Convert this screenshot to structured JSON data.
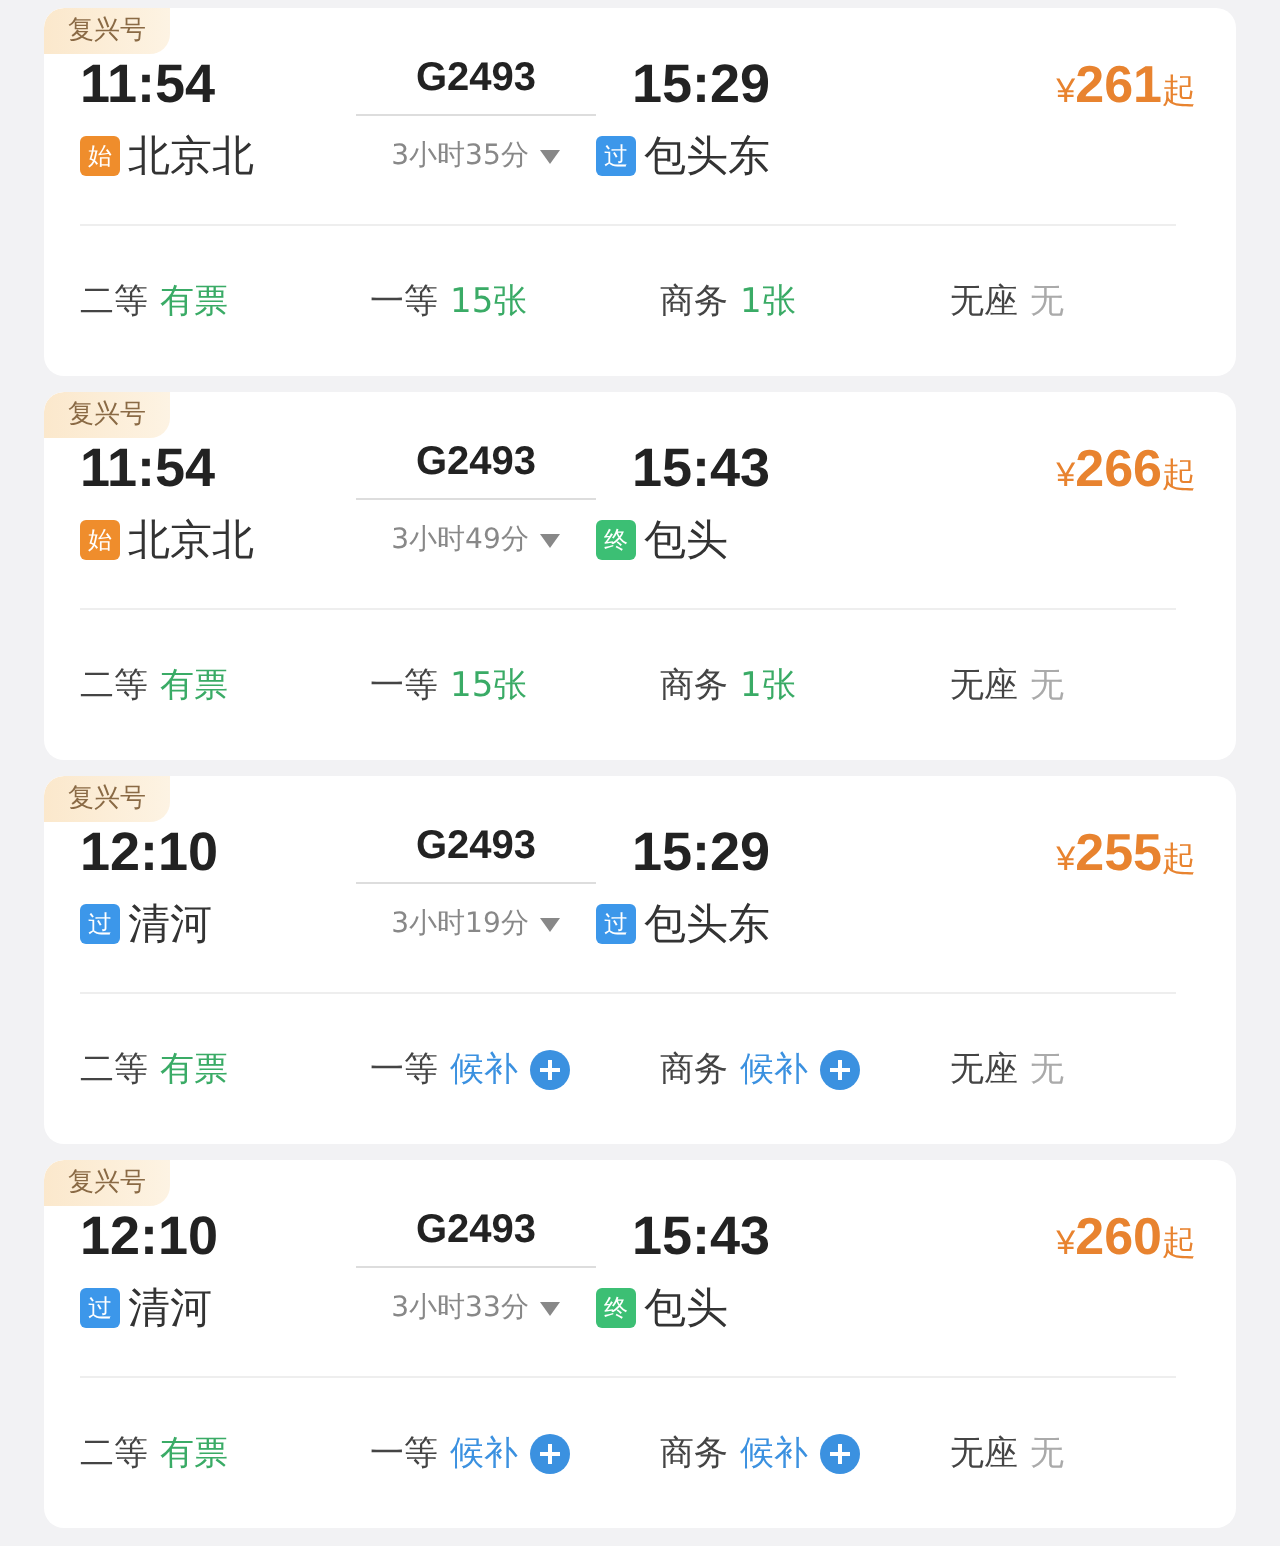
{
  "trains": [
    {
      "tag": "复兴号",
      "depart_time": "11:54",
      "train_no": "G2493",
      "arrive_time": "15:29",
      "price": {
        "currency": "¥",
        "amount": "261",
        "suffix": "起"
      },
      "duration": "3小时35分",
      "from": {
        "badge": "始",
        "kind": "start",
        "name": "北京北"
      },
      "to": {
        "badge": "过",
        "kind": "pass",
        "name": "包头东"
      },
      "seats": [
        {
          "class": "二等",
          "status": "有票",
          "kind": "available"
        },
        {
          "class": "一等",
          "status": "15张",
          "kind": "available"
        },
        {
          "class": "商务",
          "status": "1张",
          "kind": "available"
        },
        {
          "class": "无座",
          "status": "无",
          "kind": "none"
        }
      ]
    },
    {
      "tag": "复兴号",
      "depart_time": "11:54",
      "train_no": "G2493",
      "arrive_time": "15:43",
      "price": {
        "currency": "¥",
        "amount": "266",
        "suffix": "起"
      },
      "duration": "3小时49分",
      "from": {
        "badge": "始",
        "kind": "start",
        "name": "北京北"
      },
      "to": {
        "badge": "终",
        "kind": "end",
        "name": "包头"
      },
      "seats": [
        {
          "class": "二等",
          "status": "有票",
          "kind": "available"
        },
        {
          "class": "一等",
          "status": "15张",
          "kind": "available"
        },
        {
          "class": "商务",
          "status": "1张",
          "kind": "available"
        },
        {
          "class": "无座",
          "status": "无",
          "kind": "none"
        }
      ]
    },
    {
      "tag": "复兴号",
      "depart_time": "12:10",
      "train_no": "G2493",
      "arrive_time": "15:29",
      "price": {
        "currency": "¥",
        "amount": "255",
        "suffix": "起"
      },
      "duration": "3小时19分",
      "from": {
        "badge": "过",
        "kind": "pass",
        "name": "清河"
      },
      "to": {
        "badge": "过",
        "kind": "pass",
        "name": "包头东"
      },
      "seats": [
        {
          "class": "二等",
          "status": "有票",
          "kind": "available"
        },
        {
          "class": "一等",
          "status": "候补",
          "kind": "waitlist"
        },
        {
          "class": "商务",
          "status": "候补",
          "kind": "waitlist"
        },
        {
          "class": "无座",
          "status": "无",
          "kind": "none"
        }
      ]
    },
    {
      "tag": "复兴号",
      "depart_time": "12:10",
      "train_no": "G2493",
      "arrive_time": "15:43",
      "price": {
        "currency": "¥",
        "amount": "260",
        "suffix": "起"
      },
      "duration": "3小时33分",
      "from": {
        "badge": "过",
        "kind": "pass",
        "name": "清河"
      },
      "to": {
        "badge": "终",
        "kind": "end",
        "name": "包头"
      },
      "seats": [
        {
          "class": "二等",
          "status": "有票",
          "kind": "available"
        },
        {
          "class": "一等",
          "status": "候补",
          "kind": "waitlist"
        },
        {
          "class": "商务",
          "status": "候补",
          "kind": "waitlist"
        },
        {
          "class": "无座",
          "status": "无",
          "kind": "none"
        }
      ]
    }
  ]
}
